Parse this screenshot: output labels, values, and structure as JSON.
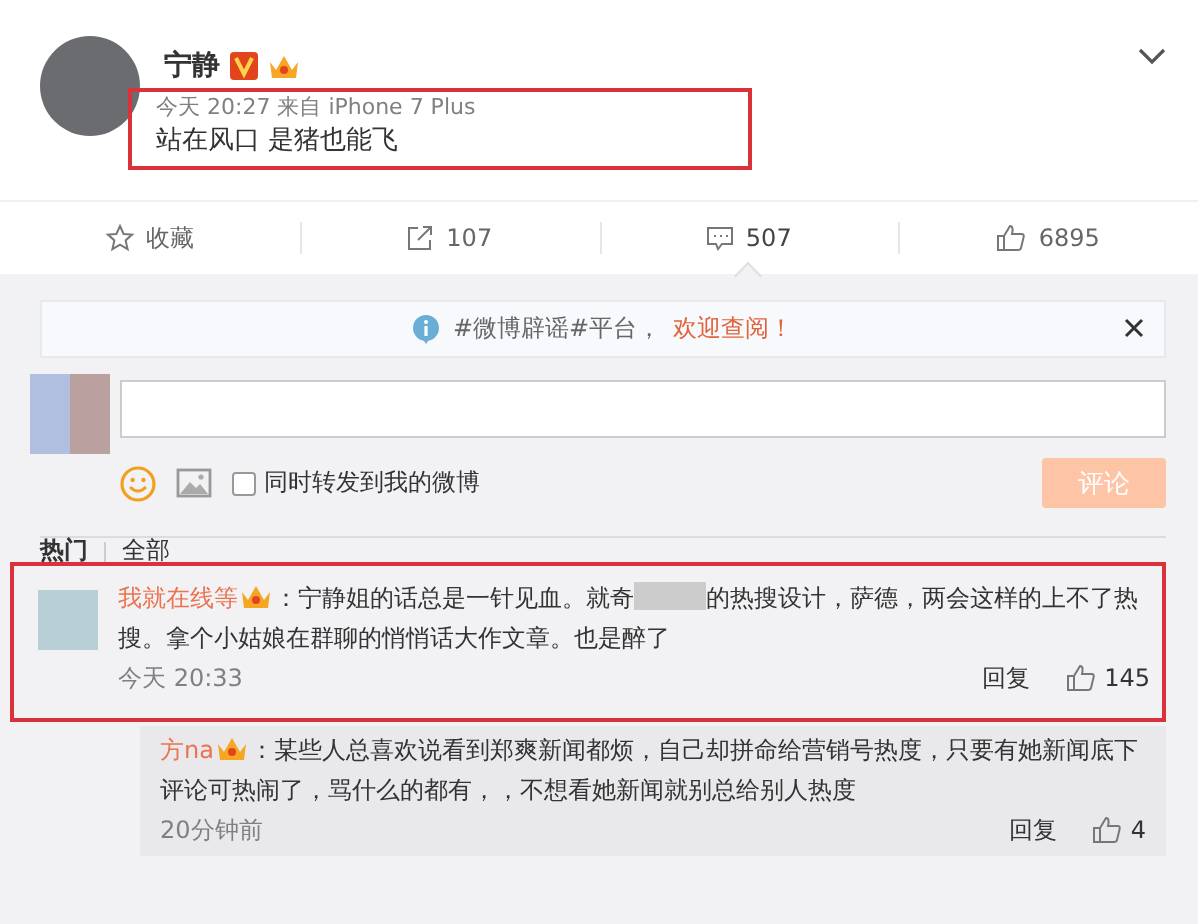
{
  "post": {
    "author": "宁静",
    "time": "今天 20:27 来自 iPhone 7 Plus",
    "text": "站在风口  是猪也能飞"
  },
  "actions": [
    {
      "kind": "favorite",
      "label": "收藏",
      "selected": false
    },
    {
      "kind": "repost",
      "label": "107",
      "selected": false
    },
    {
      "kind": "comment",
      "label": "507",
      "selected": true
    },
    {
      "kind": "like",
      "label": "6895",
      "selected": false
    }
  ],
  "notice": {
    "text": "#微博辟谣#平台，",
    "link": "欢迎查阅！"
  },
  "composer": {
    "checkbox_label": "同时转发到我的微博",
    "checked": false,
    "submit": "评论",
    "submit_disabled": true
  },
  "tabs": [
    {
      "label": "热门",
      "selected": true
    },
    {
      "label": "全部",
      "selected": false
    }
  ],
  "comments": [
    {
      "author": "我就在线等",
      "text_before": "：宁静姐的话总是一针见血。就奇",
      "text_after": "的热搜设计，萨德，两会这样的上不了热搜。拿个小姑娘在群聊的悄悄话大作文章。也是醉了",
      "time": "今天 20:33",
      "reply": "回复",
      "likes": "145",
      "replies": [
        {
          "author": "方na",
          "text": "：某些人总喜欢说看到郑爽新闻都烦，自己却拼命给营销号热度，只要有她新闻底下评论可热闹了，骂什么的都有，，不想看她新闻就别总给别人热度",
          "time": "20分钟前",
          "reply": "回复",
          "likes": "4"
        }
      ]
    }
  ]
}
